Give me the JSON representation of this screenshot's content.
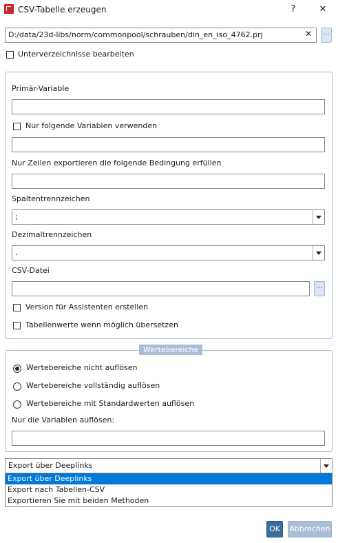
{
  "window": {
    "title": "CSV-Tabelle erzeugen",
    "help_label": "?",
    "close_label": "✕"
  },
  "path": {
    "value": "D:/data/23d-libs/norm/commonpool/schrauben/din_en_iso_4762.prj",
    "clear_label": "✕",
    "browse_label": "..."
  },
  "subdirs": {
    "label": "Unterverzeichnisse bearbeiten",
    "checked": false
  },
  "main": {
    "primary_var_label": "Primär-Variable",
    "primary_var_value": "",
    "only_vars_label": "Nur folgende Variablen verwenden",
    "only_vars_value": "",
    "condition_label": "Nur Zeilen exportieren die folgende Bedingung erfüllen",
    "condition_value": "",
    "col_sep_label": "Spaltentrennzeichen",
    "col_sep_value": ";",
    "dec_sep_label": "Dezimaltrennzeichen",
    "dec_sep_value": ".",
    "csv_file_label": "CSV-Datei",
    "csv_file_value": "",
    "csv_browse_label": "...",
    "assistant_label": "Version für Assistenten erstellen",
    "translate_label": "Tabellenwerte wenn möglich übersetzen"
  },
  "ranges": {
    "legend": "Wertebereiche",
    "options": [
      "Wertebereiche nicht auflösen",
      "Wertebereiche vollständig auflösen",
      "Wertebereiche mit Standardwerten auflösen"
    ],
    "selected_index": 0,
    "only_vars_label": "Nur die Variablen auflösen:",
    "only_vars_value": ""
  },
  "export": {
    "selected": "Export über Deeplinks",
    "options": [
      "Export über Deeplinks",
      "Export nach Tabellen-CSV",
      "Exportieren Sie mit beiden Methoden"
    ]
  },
  "buttons": {
    "ok": "OK",
    "cancel": "Abbrechen"
  },
  "colors": {
    "accent": "#0078d7",
    "ok_bg": "#3a6d9a",
    "cancel_bg": "#a9bdd6",
    "group_border": "#a9b9cf"
  }
}
